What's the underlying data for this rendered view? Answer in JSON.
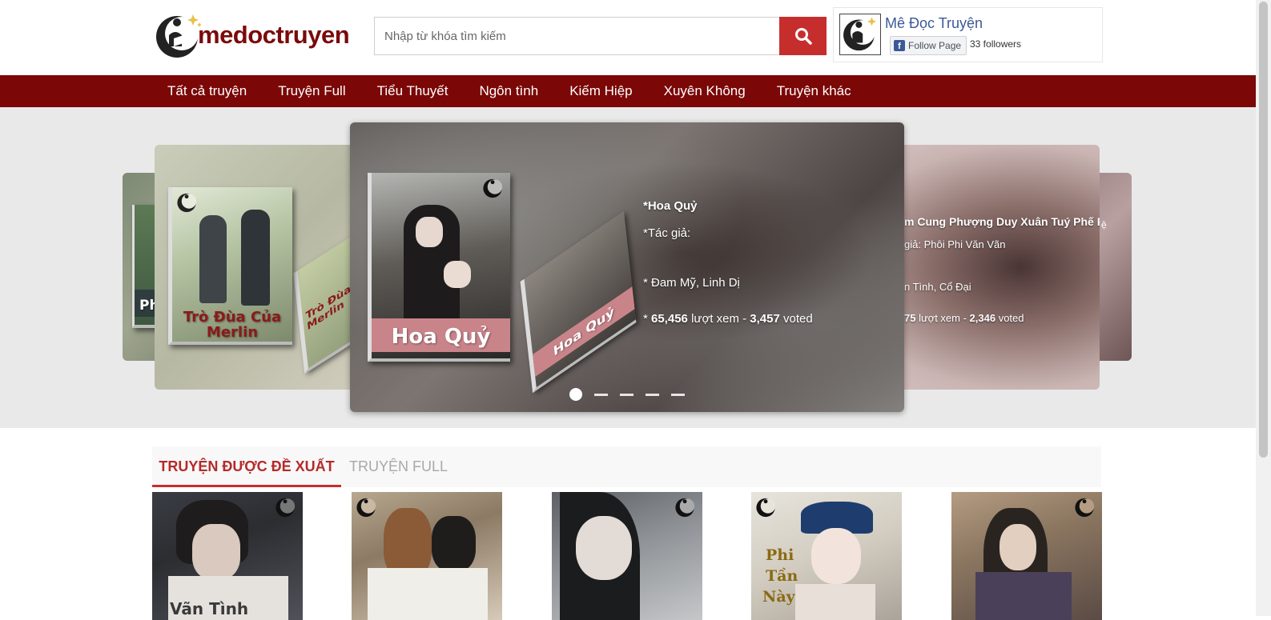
{
  "header": {
    "logo_text": "medoctruyen",
    "search": {
      "placeholder": "Nhập từ khóa tìm kiếm"
    },
    "facebook": {
      "page_name": "Mê Đọc Truyện",
      "follow_label": "Follow Page",
      "followers": "33 followers"
    }
  },
  "nav": {
    "items": [
      {
        "label": "Tất cả truyện"
      },
      {
        "label": "Truyện Full"
      },
      {
        "label": "Tiểu Thuyết"
      },
      {
        "label": "Ngôn tình"
      },
      {
        "label": "Kiếm Hiệp"
      },
      {
        "label": "Xuyên Không"
      },
      {
        "label": "Truyện khác"
      }
    ]
  },
  "carousel": {
    "far_left": {
      "cover_text": "Ph"
    },
    "left": {
      "cover_title_line1": "Trò Đùa Của",
      "cover_title_line2": "Merlin",
      "spine_title": "Trò Đùa Của Merlin"
    },
    "center": {
      "cover_title": "Hoa Quỷ",
      "title": "*Hoa Quỷ",
      "author_label": "*Tác giả:",
      "genres": "* Đam Mỹ, Linh Dị",
      "views_prefix": "* ",
      "views": "65,456",
      "views_label": " lượt xem - ",
      "votes": "3,457",
      "votes_label": " voted"
    },
    "right": {
      "title": "m Cung Phượng Duy Xuân Tuý Phế Phi",
      "author": "giả: Phôi Phi Văn Vãn",
      "genres": "n Tình, Cổ Đại",
      "views": "75",
      "views_label": " lượt xem - ",
      "votes": "2,346",
      "votes_label": " voted"
    },
    "far_right": {
      "text": "ệ"
    },
    "slide_count": 5,
    "active_slide": 1
  },
  "tabs": [
    {
      "label": "TRUYỆN ĐƯỢC ĐỀ XUẤT",
      "active": true
    },
    {
      "label": "TRUYỆN FULL",
      "active": false
    }
  ],
  "grid": {
    "cards": [
      {
        "cover_text": "Vãn Tình"
      },
      {
        "cover_text": ""
      },
      {
        "cover_text": ""
      },
      {
        "cover_text_line1": "Phi",
        "cover_text_line2": "Tần",
        "cover_text_line3": "Này"
      },
      {
        "cover_text": ""
      }
    ]
  },
  "colors": {
    "brand": "#7b0707",
    "accent": "#c62e2e",
    "fb_blue": "#3b5998"
  }
}
